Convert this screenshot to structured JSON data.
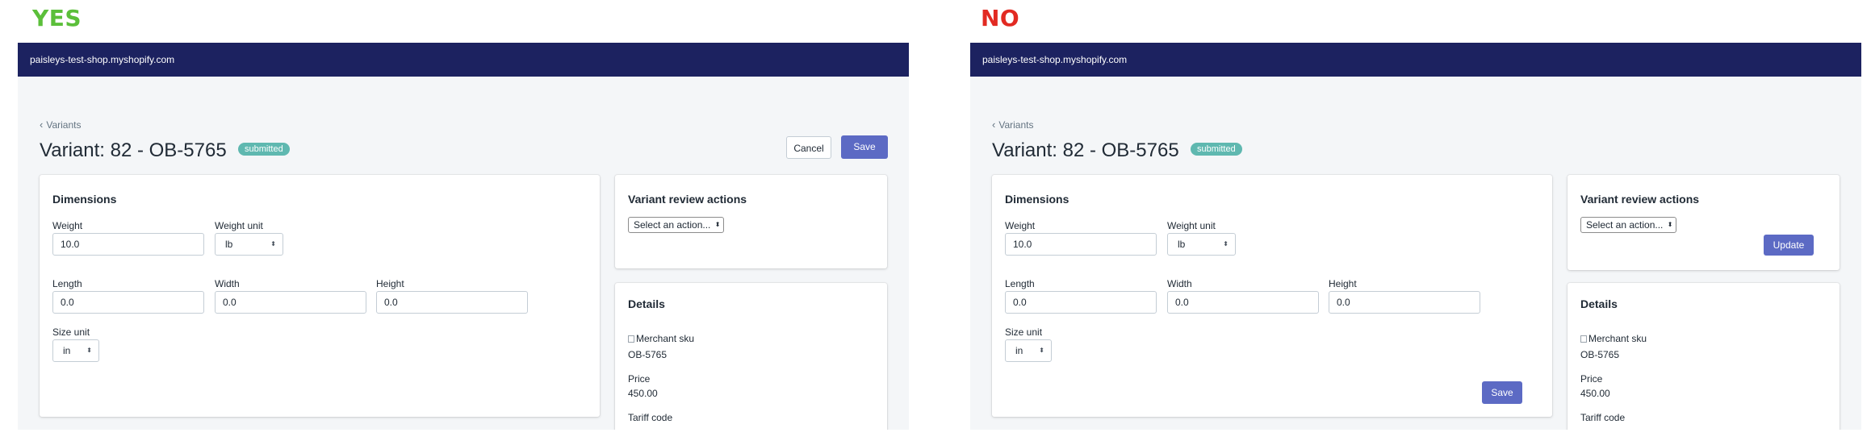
{
  "verdicts": {
    "yes": "YES",
    "no": "NO"
  },
  "store": "paisleys-test-shop.myshopify.com",
  "breadcrumb": "Variants",
  "title": "Variant: 82 - OB-5765",
  "status_badge": "submitted",
  "header_buttons": {
    "cancel": "Cancel",
    "save": "Save"
  },
  "dimensions": {
    "title": "Dimensions",
    "weight_label": "Weight",
    "weight_value": "10.0",
    "weight_unit_label": "Weight unit",
    "weight_unit_value": "lb",
    "length_label": "Length",
    "length_value": "0.0",
    "width_label": "Width",
    "width_value": "0.0",
    "height_label": "Height",
    "height_value": "0.0",
    "size_unit_label": "Size unit",
    "size_unit_value": "in",
    "save_label": "Save"
  },
  "review": {
    "title": "Variant review actions",
    "select_value": "Select an action...",
    "update_label": "Update"
  },
  "details": {
    "title": "Details",
    "merchant_sku_alt": "Merchant sku",
    "sku_value": "OB-5765",
    "price_label": "Price",
    "price_value": "450.00",
    "tariff_label": "Tariff code"
  },
  "colors": {
    "topbar": "#1c2260",
    "primary": "#5c6ac4",
    "badge": "#5fb8b0",
    "yes": "#5bbf3a",
    "no": "#e22a22"
  },
  "icons": {
    "back": "chevron-left-icon",
    "select_caret": "up-down-caret-icon",
    "broken_image": "broken-image-icon"
  }
}
